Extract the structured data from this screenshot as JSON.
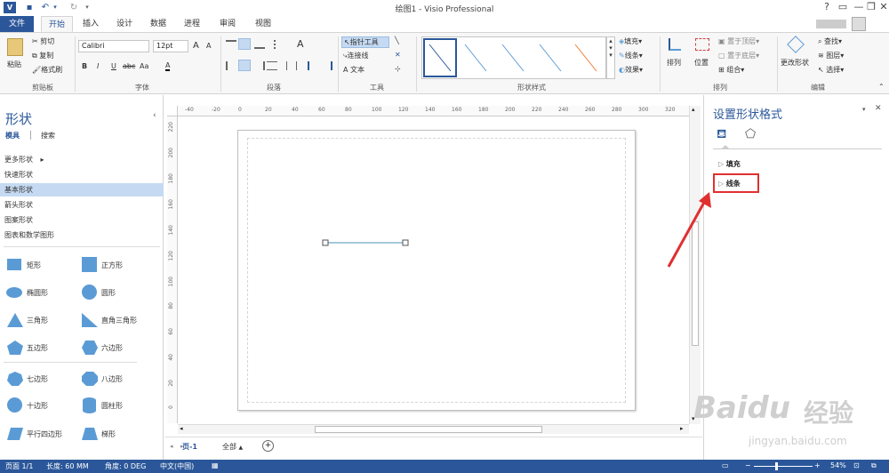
{
  "app": {
    "title": "绘图1 - Visio Professional",
    "help": "?",
    "win_min": "—",
    "win_restore": "❐",
    "win_close": "✕"
  },
  "tabs": [
    {
      "label": "文件"
    },
    {
      "label": "开始"
    },
    {
      "label": "插入"
    },
    {
      "label": "设计"
    },
    {
      "label": "数据"
    },
    {
      "label": "进程"
    },
    {
      "label": "审阅"
    },
    {
      "label": "视图"
    }
  ],
  "ribbon": {
    "clipboard": {
      "paste": "粘贴",
      "cut": "剪切",
      "copy": "复制",
      "format_painter": "格式刷",
      "label": "剪贴板"
    },
    "font": {
      "name": "Calibri",
      "size": "12pt",
      "grow": "A",
      "shrink": "A",
      "bold": "B",
      "italic": "I",
      "underline": "U",
      "strike": "abc",
      "case": "Aa",
      "color": "A",
      "label": "字体"
    },
    "paragraph": {
      "label": "段落"
    },
    "tools": {
      "pointer": "指针工具",
      "connector": "连接线",
      "text": "文本",
      "label": "工具"
    },
    "shape_styles": {
      "label": "形状样式"
    },
    "quick": {
      "fill": "填充",
      "line": "线条",
      "effects": "效果"
    },
    "arrange": {
      "align": "排列",
      "position": "位置",
      "bring_front": "置于顶层",
      "send_back": "置于底层",
      "group": "组合",
      "label": "排列"
    },
    "editing": {
      "change_shape": "更改形状",
      "find": "查找",
      "layers": "图层",
      "select": "选择",
      "label": "编辑"
    }
  },
  "shapes_pane": {
    "title": "形状",
    "tab_stencils": "模具",
    "tab_search": "搜索",
    "more_shapes": "更多形状",
    "stencils": [
      "快速形状",
      "基本形状",
      "箭头形状",
      "图案形状",
      "图表和数学图形"
    ],
    "selected_stencil": "基本形状",
    "shapes": [
      {
        "label": "矩形",
        "icon": "rectangle-shape"
      },
      {
        "label": "正方形",
        "icon": "square-shape"
      },
      {
        "label": "椭圆形",
        "icon": "ellipse-shape"
      },
      {
        "label": "圆形",
        "icon": "circle-shape"
      },
      {
        "label": "三角形",
        "icon": "triangle-shape"
      },
      {
        "label": "直角三角形",
        "icon": "right-triangle-shape"
      },
      {
        "label": "五边形",
        "icon": "pentagon-shape"
      },
      {
        "label": "六边形",
        "icon": "hexagon-shape"
      },
      {
        "label": "七边形",
        "icon": "heptagon-shape"
      },
      {
        "label": "八边形",
        "icon": "octagon-shape"
      },
      {
        "label": "十边形",
        "icon": "decagon-shape"
      },
      {
        "label": "圆柱形",
        "icon": "cylinder-shape"
      },
      {
        "label": "平行四边形",
        "icon": "parallelogram-shape"
      },
      {
        "label": "梯形",
        "icon": "trapezoid-shape"
      }
    ]
  },
  "ruler": {
    "h_ticks": [
      "-40",
      "-20",
      "0",
      "20",
      "40",
      "60",
      "80",
      "100",
      "120",
      "140",
      "160",
      "180",
      "200",
      "220",
      "240",
      "260",
      "280",
      "300",
      "320"
    ],
    "v_ticks": [
      "220",
      "200",
      "180",
      "160",
      "140",
      "120",
      "100",
      "80",
      "60",
      "40",
      "20",
      "0"
    ]
  },
  "page_tabs": {
    "page": "页-1",
    "all": "全部",
    "add": "+"
  },
  "format_pane": {
    "title": "设置形状格式",
    "fill": "填充",
    "line": "线条"
  },
  "status": {
    "page": "页面 1/1",
    "length": "长度: 60 MM",
    "angle": "角度: 0 DEG",
    "language": "中文(中国)",
    "zoom": "54%"
  },
  "watermark": {
    "brand": "Baidu",
    "cn": "经验",
    "url": "jingyan.baidu.com"
  },
  "colors": {
    "accent": "#2b579a",
    "shape_fill": "#5b9bd5",
    "highlight": "#e03030",
    "selected": "#c5daf2"
  }
}
